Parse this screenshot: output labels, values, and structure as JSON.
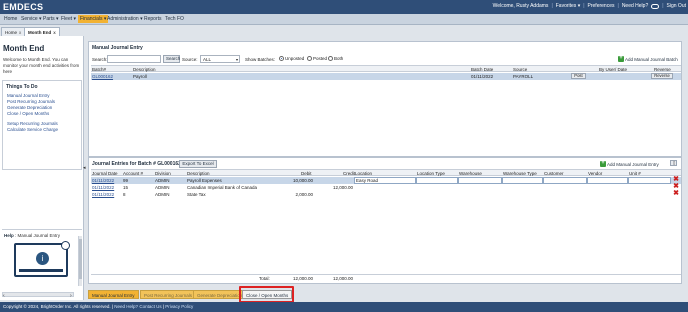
{
  "brand": {
    "logo_main": "EMDECS",
    "logo_accent": ""
  },
  "userbar": {
    "welcome": "Welcome, Rusty Addams",
    "favorites": "Favorites ▾",
    "preferences": "Preferences",
    "help": "Need Help?",
    "signout": "Sign Out"
  },
  "nav": {
    "items": [
      {
        "label": "Home"
      },
      {
        "label": "Service ▾"
      },
      {
        "label": "Parts ▾"
      },
      {
        "label": "Fleet ▾"
      },
      {
        "label": "Financials ▾"
      },
      {
        "label": "Administration ▾"
      },
      {
        "label": "Reports"
      },
      {
        "label": "Tech FO"
      }
    ]
  },
  "tabs": [
    {
      "label": "Home"
    },
    {
      "label": "Month End"
    }
  ],
  "left": {
    "title": "Month End",
    "welcome": "Welcome to Month End. You can monitor your month end activities from here",
    "todo_title": "Things To Do",
    "todo_links": [
      "Manual Journal Entry",
      "Post Recurring Journals",
      "Generate Depreciation",
      "Close / Open Months",
      "Setup Recurring Journals",
      "Calculate Service Charge"
    ],
    "help_label": "Help",
    "help_topic": "Manual Journal Entry"
  },
  "batch": {
    "title": "Manual Journal Entry",
    "search_label": "Search:",
    "search_value": "",
    "search_button": "Search",
    "source_label": "Source:",
    "source_value": "ALL",
    "show_batches_label": "Show Batches:",
    "radios": [
      "Unposted",
      "Posted",
      "Both"
    ],
    "add_label": "Add Manual Journal Batch",
    "columns": [
      "Batch#",
      "Description",
      "Batch Date",
      "Source",
      "By User/ Date",
      "Reverse"
    ],
    "rows": [
      {
        "batch": "GL000162",
        "description": "Payroll",
        "date": "01/11/2022",
        "source": "PAYROLL",
        "post": "Post",
        "reverse": "Reverse"
      }
    ]
  },
  "entries": {
    "title": "Journal Entries for Batch # GL000162",
    "export_button": "Export To Excel",
    "add_label": "Add Manual Journal Entry",
    "columns": [
      "Journal Date",
      "Account #",
      "Division",
      "Description",
      "Debit",
      "Credit",
      "Location",
      "Location Type",
      "Warehouse",
      "Warehouse Type",
      "Customer",
      "Vendor",
      "Unit #"
    ],
    "rows": [
      {
        "date": "01/11/2022",
        "account": "99",
        "division": "ADMIN",
        "description": "Payroll Expenses",
        "debit": "10,000.00",
        "credit": "",
        "location": "Easy Road"
      },
      {
        "date": "01/11/2022",
        "account": "15",
        "division": "ADMIN",
        "description": "Canadian Imperial Bank of Canada",
        "debit": "",
        "credit": "12,000.00",
        "location": ""
      },
      {
        "date": "01/11/2022",
        "account": "8",
        "division": "ADMIN",
        "description": "State Tax",
        "debit": "2,000.00",
        "credit": "",
        "location": ""
      }
    ],
    "total_label": "Total:",
    "total_debit": "12,000.00",
    "total_credit": "12,000.00"
  },
  "bottom_tabs": [
    "Manual Journal Entry",
    "Post Recurring Journals",
    "Generate Depreciation",
    "Close / Open Months"
  ],
  "footer": {
    "copyright": "Copyright © 2024, BrightOrder Inc. All rights reserved.",
    "help": "Need Help? Contact Us",
    "privacy": "Privacy Policy"
  }
}
